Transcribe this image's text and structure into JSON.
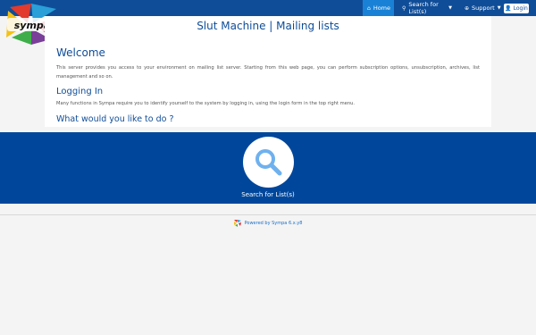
{
  "logo": {
    "text": "sympa"
  },
  "nav": {
    "home": "Home",
    "search": "Search for List(s)",
    "support": "Support",
    "login": "Login"
  },
  "header": {
    "title": "Slut Machine | Mailing lists"
  },
  "welcome": {
    "heading": "Welcome",
    "body": "This server provides you access to your environment on mailing list server. Starting from this web page, you can perform subscription options, unsubscription, archives, list management and so on."
  },
  "logging_in": {
    "heading": "Logging In",
    "body": "Many functions in Sympa require you to identify yourself to the system by logging in, using the login form in the top right menu."
  },
  "what_to_do": {
    "heading": "What would you like to do ?"
  },
  "search_tile": {
    "label": "Search for List(s)"
  },
  "footer": {
    "powered": "Powered by Sympa 6.x.y8"
  },
  "colors": {
    "nav_bg": "#0f4d98",
    "nav_active": "#1a82d6",
    "band_bg": "#00479b",
    "heading": "#0f4d98",
    "magnifier": "#6fb1ee"
  }
}
